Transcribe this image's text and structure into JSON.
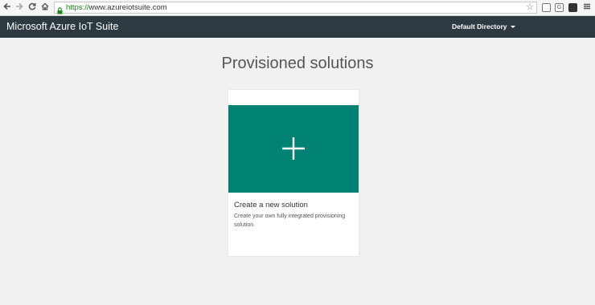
{
  "browser": {
    "url_scheme": "https://",
    "url_host": "www.azureiotsuite.com",
    "ext_g": "G"
  },
  "header": {
    "title": "Microsoft Azure IoT Suite",
    "directory": "Default Directory"
  },
  "page": {
    "title": "Provisioned solutions"
  },
  "card": {
    "title": "Create a new solution",
    "description": "Create your own fully integrated provisioning solution",
    "tile_color": "#008272"
  },
  "colors": {
    "header_bg": "#2e3a41",
    "page_bg": "#f1f1f1",
    "accent": "#008272"
  },
  "icons": [
    "back-icon",
    "forward-icon",
    "reload-icon",
    "home-icon",
    "lock-icon",
    "star-icon",
    "plus-icon",
    "caret-down-icon"
  ]
}
